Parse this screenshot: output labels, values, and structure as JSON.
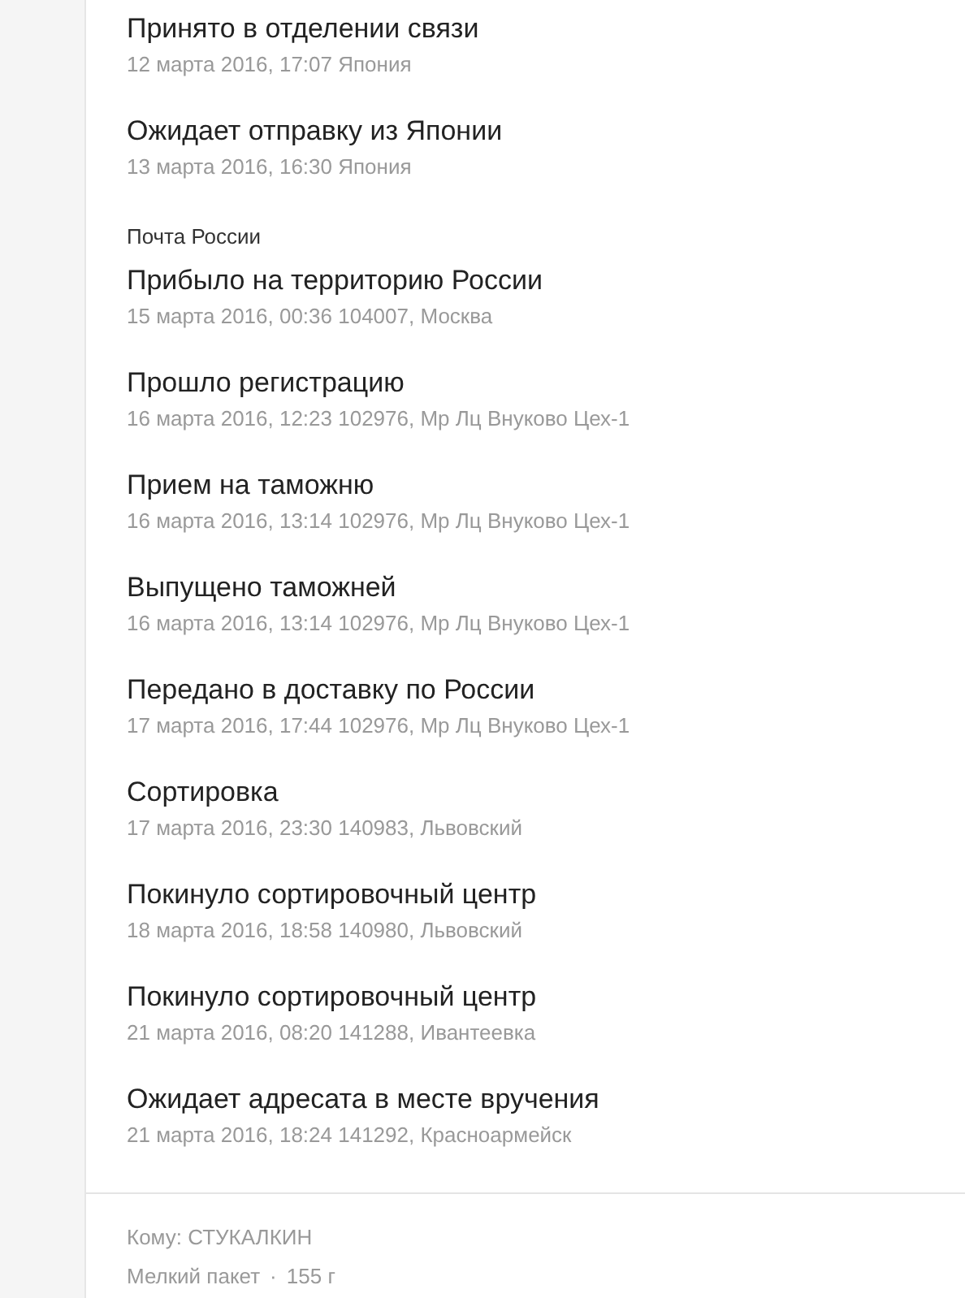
{
  "groups": [
    {
      "events": [
        {
          "title": "Принято в отделении связи",
          "details": "12 марта 2016, 17:07 Япония"
        },
        {
          "title": "Ожидает отправку из Японии",
          "details": "13 марта 2016, 16:30 Япония"
        }
      ]
    },
    {
      "header": "Почта России",
      "events": [
        {
          "title": "Прибыло на территорию России",
          "details": "15 марта 2016, 00:36 104007, Москва"
        },
        {
          "title": "Прошло регистрацию",
          "details": "16 марта 2016, 12:23 102976, Мр Лц Внуково Цех-1"
        },
        {
          "title": "Прием на таможню",
          "details": "16 марта 2016, 13:14 102976, Мр Лц Внуково Цех-1"
        },
        {
          "title": "Выпущено таможней",
          "details": "16 марта 2016, 13:14 102976, Мр Лц Внуково Цех-1"
        },
        {
          "title": "Передано в доставку по России",
          "details": "17 марта 2016, 17:44 102976, Мр Лц Внуково Цех-1"
        },
        {
          "title": "Сортировка",
          "details": "17 марта 2016, 23:30 140983, Львовский"
        },
        {
          "title": "Покинуло сортировочный центр",
          "details": "18 марта 2016, 18:58 140980, Львовский"
        },
        {
          "title": "Покинуло сортировочный центр",
          "details": "21 марта 2016, 08:20 141288, Ивантеевка"
        },
        {
          "title": "Ожидает адресата в месте вручения",
          "details": "21 марта 2016, 18:24 141292, Красноармейск"
        }
      ]
    }
  ],
  "footer": {
    "recipient": "Кому: СТУКАЛКИН",
    "package_type": "Мелкий пакет",
    "separator": "·",
    "weight": "155 г"
  }
}
